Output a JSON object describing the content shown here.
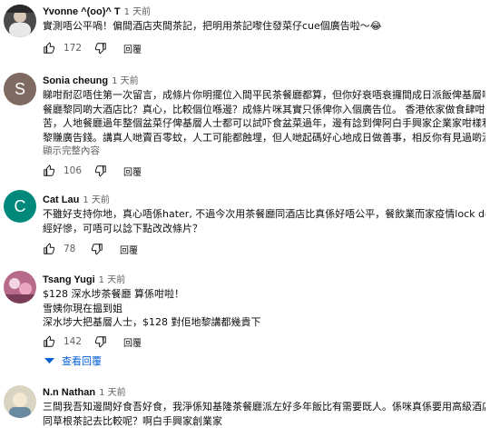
{
  "comments": [
    {
      "author": "Yvonne ^(oo)^ T",
      "time": "1 天前",
      "lines": [
        "實測唔公平喎！偏間酒店夾間茶記，把明用茶記嚟住發菜仔cue個廣告啦～😂"
      ],
      "likes": "172",
      "reply_label": "回覆",
      "avatar_icon": "photo-avatar"
    },
    {
      "author": "Sonia cheung",
      "time": "1 天前",
      "avatar_letter": "S",
      "avatar_color": "#7e6a60",
      "lines": [
        "睇咁耐忍唔住第一次留言，成條片你明擺位入間平民茶餐廳都算，但你好衰唔衰攞間成日派飯俾基層嘅茶",
        "餐廳黎同啲大酒店比？真心，比較個位喺邊？成條片咪其實只係俾你入個廣告位。 香港依家做食肆咁辛",
        "苦，人地餐廳過年整個盆菜仔俾基層人士都可以試吓食盆菜過年，邊有諗到俾阿白手興家企業家咁樣利用",
        "黎賺廣告錢。講真人哋賣百零蚊，人工可能都蝕埋，但人哋起碼好心地成日做善事，相反你有見過啲酒..."
      ],
      "read_more": "顯示完整內容",
      "likes": "106",
      "reply_label": "回覆"
    },
    {
      "author": "Cat Lau",
      "time": "1 天前",
      "avatar_letter": "C",
      "avatar_color": "#00897b",
      "lines": [
        "不雖好支持你地，真心唔係hater, 不過今次用茶餐廳同酒店比真係好唔公平，餐飲業而家疫情lock down 已",
        "經好慘，可唔可以諗下點改改條片？"
      ],
      "likes": "78",
      "reply_label": "回覆"
    },
    {
      "author": "Tsang Yugi",
      "time": "1 天前",
      "lines": [
        "$128 深水埗茶餐廳 算係咁啦！",
        "雪姨你現在揾到姐",
        "深水埗大把基層人士，$128 對佢地黎講都幾貴下"
      ],
      "likes": "142",
      "reply_label": "回覆",
      "view_replies": "查看回覆",
      "avatar_icon": "photo-avatar"
    },
    {
      "author": "N.n Nathan",
      "time": "1 天前",
      "lines": [
        "三間我吾知邊間好食吾好食，我淨係知基隆茶餐廳派左好多年飯比有需要既人。係咪真係要用高級酒店去",
        "同草根茶記去比較呢？啊白手興家創業家"
      ],
      "avatar_icon": "photo-avatar"
    }
  ],
  "colors": {
    "link": "#065fd4",
    "meta": "#606060",
    "text": "#0f0f0f"
  }
}
